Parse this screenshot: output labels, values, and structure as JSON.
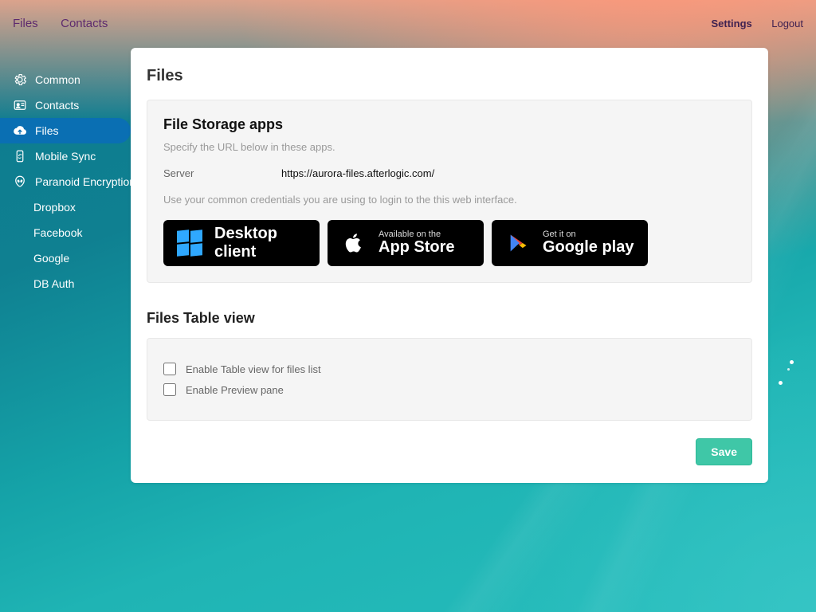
{
  "header": {
    "nav_left": [
      "Files",
      "Contacts"
    ],
    "nav_right": [
      "Settings",
      "Logout"
    ]
  },
  "sidebar": {
    "items": [
      {
        "icon": "gear",
        "label": "Common"
      },
      {
        "icon": "idcard",
        "label": "Contacts"
      },
      {
        "icon": "cloud",
        "label": "Files",
        "active": true
      },
      {
        "icon": "mobile",
        "label": "Mobile Sync"
      },
      {
        "icon": "alien",
        "label": "Paranoid Encryption"
      }
    ],
    "sub_items": [
      "Dropbox",
      "Facebook",
      "Google",
      "DB Auth"
    ]
  },
  "page": {
    "title": "Files",
    "storage": {
      "title": "File Storage apps",
      "desc": "Specify the URL below in these apps.",
      "server_label": "Server",
      "server_value": "https://aurora-files.afterlogic.com/",
      "hint": "Use your common credentials you are using to login to the this web interface.",
      "badges": {
        "desktop": {
          "line1": "Desktop",
          "line2": "client"
        },
        "appstore": {
          "small": "Available on the",
          "big": "App Store"
        },
        "play": {
          "small": "Get it on",
          "big": "Google play"
        }
      }
    },
    "table_view": {
      "title": "Files Table view",
      "opt1": "Enable Table view for files list",
      "opt2": "Enable Preview pane"
    },
    "save": "Save"
  }
}
